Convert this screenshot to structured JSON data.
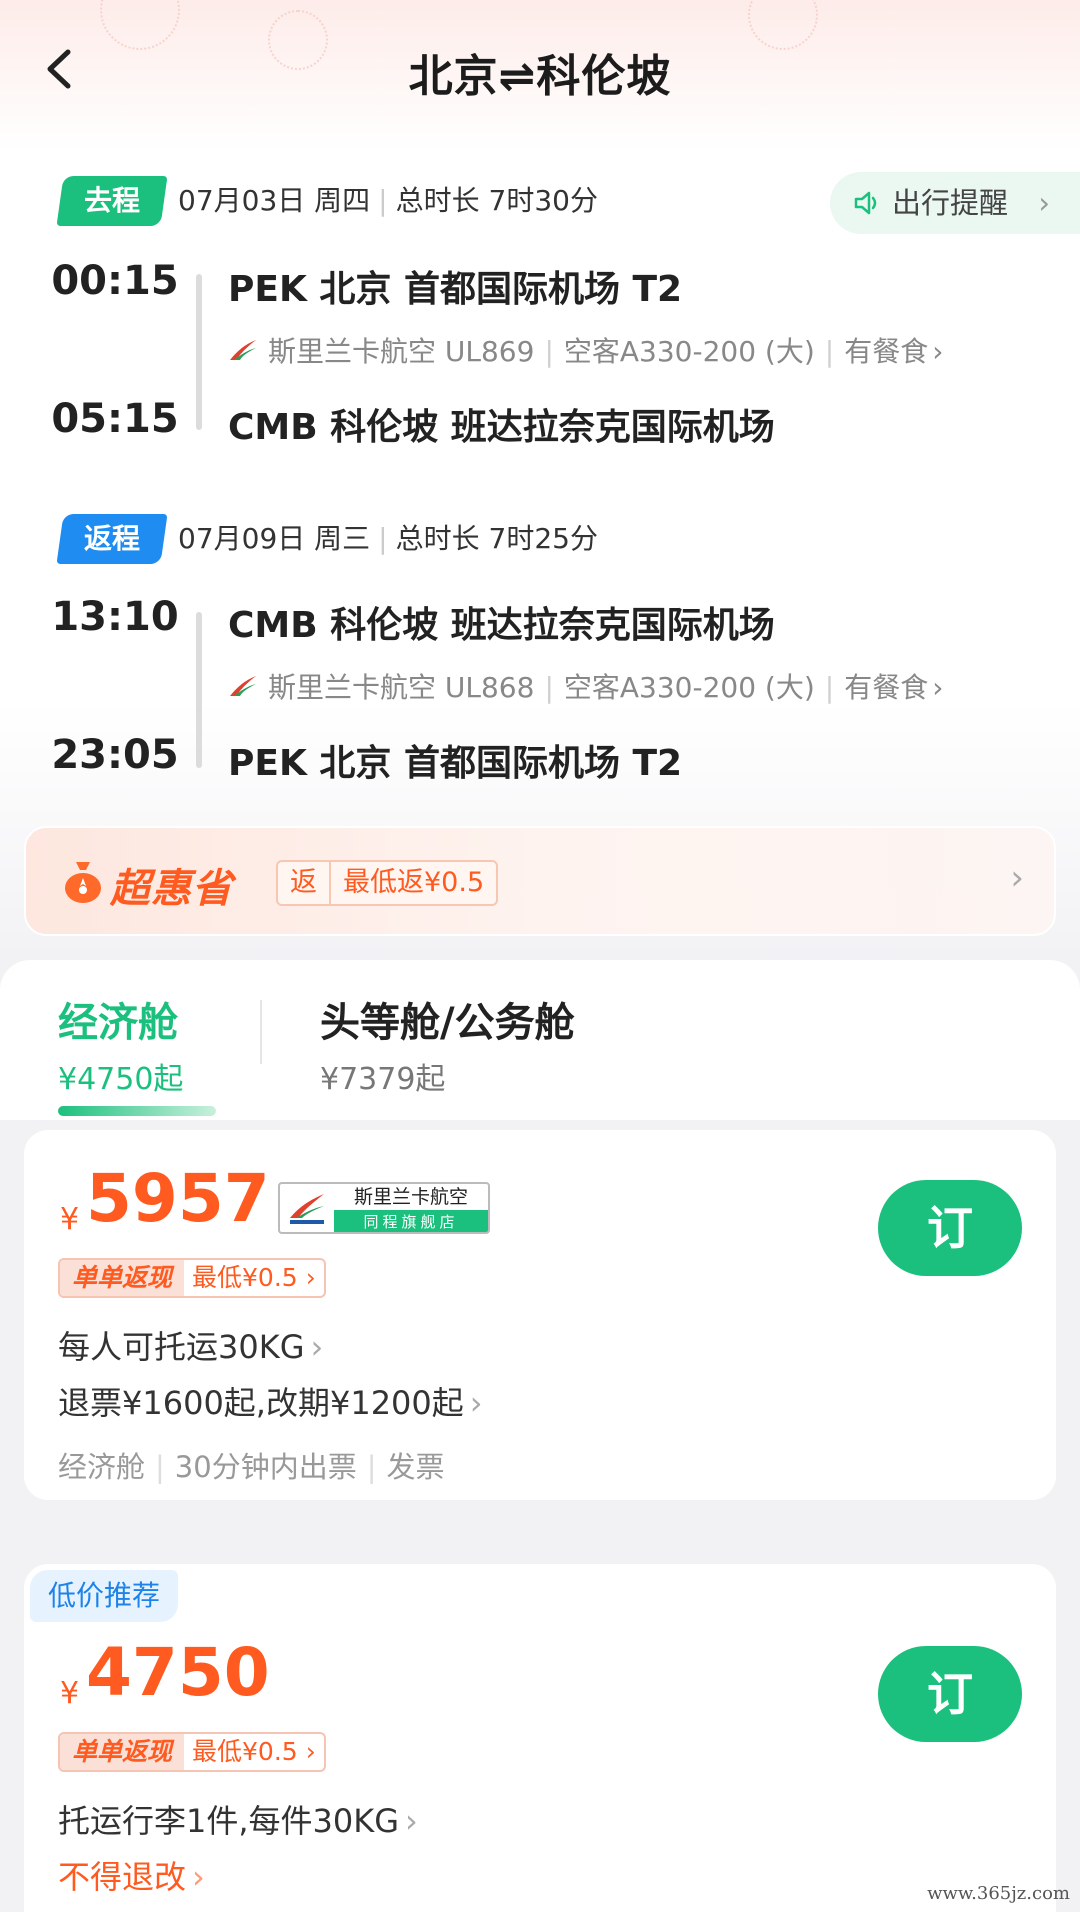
{
  "header": {
    "title": "北京⇌科伦坡"
  },
  "outbound": {
    "tag": "去程",
    "tag_color": "#1cc07e",
    "date": "07月03日 周四",
    "duration": "总时长 7时30分",
    "reminder": "出行提醒",
    "depart_time": "00:15",
    "arrive_time": "05:15",
    "depart_airport": "PEK 北京 首都国际机场 T2",
    "arrive_airport": "CMB 科伦坡 班达拉奈克国际机场",
    "airline": "斯里兰卡航空 UL869",
    "aircraft": "空客A330-200 (大)",
    "meal": "有餐食"
  },
  "return": {
    "tag": "返程",
    "tag_color": "#1e8cf0",
    "date": "07月09日 周三",
    "duration": "总时长 7时25分",
    "depart_time": "13:10",
    "arrive_time": "23:05",
    "depart_airport": "CMB 科伦坡 班达拉奈克国际机场",
    "arrive_airport": "PEK 北京 首都国际机场 T2",
    "airline": "斯里兰卡航空 UL868",
    "aircraft": "空客A330-200 (大)",
    "meal": "有餐食"
  },
  "promo": {
    "title": "超惠省",
    "chip_key": "返",
    "chip_value": "最低返¥0.5"
  },
  "cabins": [
    {
      "name": "经济舱",
      "price": "¥4750起",
      "active": true
    },
    {
      "name": "头等舱/公务舱",
      "price": "¥7379起",
      "active": false
    }
  ],
  "offers": [
    {
      "currency": "¥",
      "price": "5957",
      "shop_name": "斯里兰卡航空",
      "shop_sub": "同程旗舰店",
      "cash_key": "单单返现",
      "cash_value": "最低¥0.5",
      "baggage": "每人可托运30KG",
      "refund": "退票¥1600起,改期¥1200起",
      "tags": [
        "经济舱",
        "30分钟内出票",
        "发票"
      ],
      "book": "订"
    },
    {
      "label": "低价推荐",
      "currency": "¥",
      "price": "4750",
      "cash_key": "单单返现",
      "cash_value": "最低¥0.5",
      "baggage": "托运行李1件,每件30KG",
      "refund": "不得退改",
      "book": "订"
    }
  ],
  "watermark": "www.365jz.com",
  "colors": {
    "accent_green": "#1cc07e",
    "price_orange": "#ff5a1f",
    "return_blue": "#1e8cf0"
  }
}
